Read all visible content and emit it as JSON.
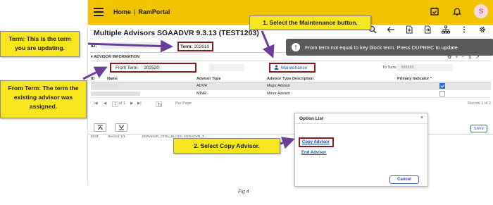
{
  "header": {
    "home_label": "Home",
    "separator": "|",
    "app_label": "RamPortal",
    "avatar_initial": "S",
    "brand_color": "#f2c400"
  },
  "form": {
    "title": "Multiple Advisors SGAADVR 9.3.13 (TEST1203)"
  },
  "key_block": {
    "id_label": "ID:",
    "term_label": "Term:",
    "term_value": "202610"
  },
  "notification": {
    "icon": "info-icon",
    "message": "From term not equal to key block term. Press DUPREC to update."
  },
  "section": {
    "title": "ADVISOR INFORMATION"
  },
  "fields": {
    "from_term_label": "From Term",
    "from_term_value": "202520",
    "maintenance_label": "Maintenance",
    "to_term_label": "To Term",
    "to_term_placeholder": "999999"
  },
  "grid": {
    "headers": [
      "ID",
      "Name",
      "Advisor Type",
      "Advisor Type Description",
      "Primary Indicator *"
    ],
    "rows": [
      {
        "type": "ADVR",
        "description": "Major Advisor",
        "primary": true
      },
      {
        "type": "MINR",
        "description": "Minor Advisor",
        "primary": false
      }
    ]
  },
  "pager": {
    "page_text": "1",
    "of_text": "of 1",
    "per_page_value": "10",
    "per_page_label": "Per Page",
    "record_text": "Record 1 of 2"
  },
  "buttons": {
    "save_label": "SAVE"
  },
  "status_bar": {
    "mode": "EDIT",
    "record": "Record: 1/1",
    "block": "SGRADVR_CTRL_BLOCK.SGRADVR_T..."
  },
  "modal": {
    "title": "Option List",
    "close": "×",
    "option1": "Copy Advisor",
    "option2": "End Advisor",
    "cancel": "Cancel"
  },
  "callouts": {
    "term": "Term:  This is the term you are updating.",
    "from_term": "From Term:  The term the existing advisor was assigned.",
    "step1": "1.  Select the Maintenance button.",
    "step2": "2.  Select Copy Advisor."
  },
  "caption": "Fig 4"
}
